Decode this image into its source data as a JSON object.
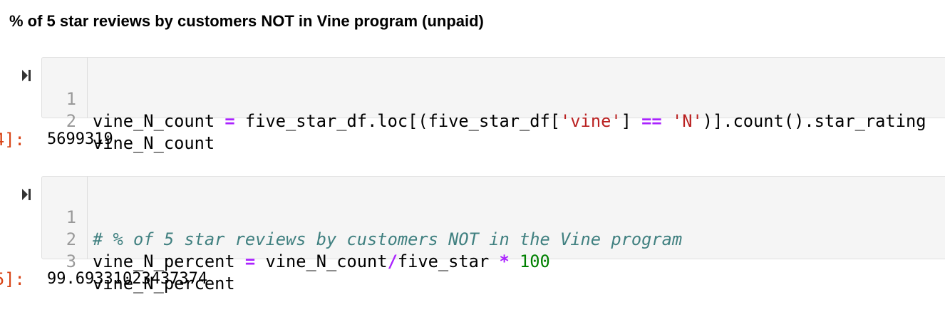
{
  "heading": "% of 5 star reviews by customers NOT in Vine program (unpaid)",
  "cells": [
    {
      "lines": [
        {
          "num": "1",
          "tokens": [
            "vine_N_count ",
            "=",
            " five_star_df.loc[(five_star_df[",
            "'vine'",
            "] ",
            "==",
            " ",
            "'N'",
            ")].count().star_rating"
          ]
        },
        {
          "num": "2",
          "tokens": [
            "vine_N_count"
          ]
        }
      ],
      "output_prompt": "4]:",
      "output": "5699319"
    },
    {
      "lines": [
        {
          "num": "1",
          "tokens": [
            "# % of 5 star reviews by customers NOT in the Vine program"
          ]
        },
        {
          "num": "2",
          "tokens": [
            "vine_N_percent ",
            "=",
            " vine_N_count",
            "/",
            "five_star ",
            "*",
            " ",
            "100"
          ]
        },
        {
          "num": "3",
          "tokens": [
            "vine_N_percent"
          ]
        }
      ],
      "output_prompt": "5]:",
      "output": "99.69331023437374"
    }
  ]
}
